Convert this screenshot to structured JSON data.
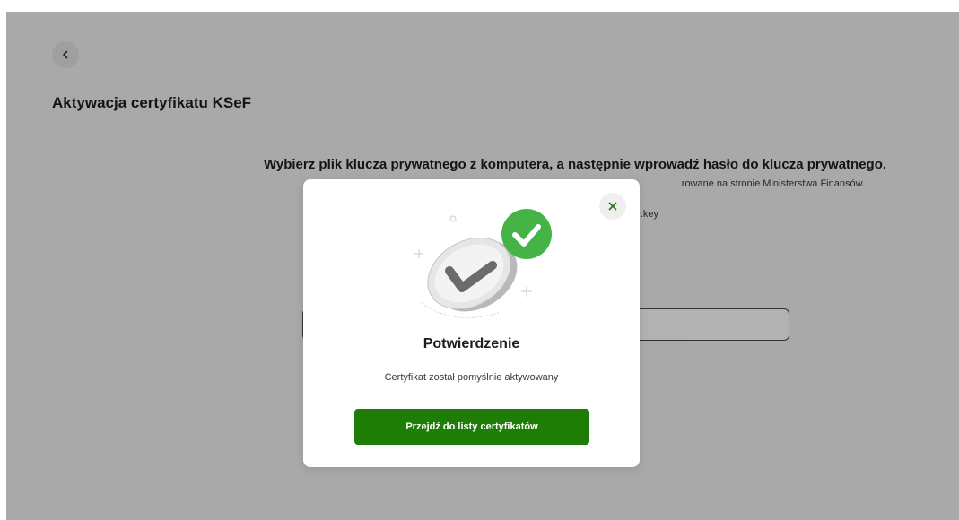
{
  "page": {
    "title": "Aktywacja certyfikatu KSeF",
    "instruction": "Wybierz plik klucza prywatnego z komputera, a następnie wprowadź hasło do klucza prywatnego.",
    "info_text_visible": "rowane na stronie Ministerstwa Finansów.",
    "file_name_visible": ".key",
    "back_icon": "chevron-left-icon"
  },
  "modal": {
    "title": "Potwierdzenie",
    "message": "Certyfikat został pomyślnie aktywowany",
    "button_label": "Przejdź do listy certyfikatów",
    "close_icon": "close-icon",
    "illustration_icon": "success-check-icon"
  },
  "colors": {
    "primary_green": "#1e7d07",
    "check_green": "#46b347",
    "overlay": "rgba(0,0,0,0.30)",
    "close_x": "#2d7a1e"
  }
}
